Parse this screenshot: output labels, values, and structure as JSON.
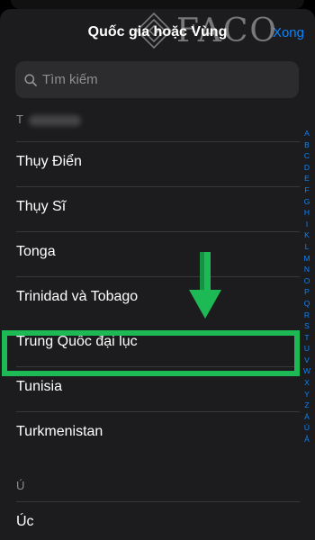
{
  "header": {
    "title": "Quốc gia hoặc Vùng",
    "done_label": "Xong"
  },
  "watermark": {
    "text": "FACO"
  },
  "search": {
    "placeholder": "Tìm kiếm"
  },
  "sections": [
    {
      "letter": "T",
      "items": [
        "Thụy Điển",
        "Thụy Sĩ",
        "Tonga",
        "Trinidad và Tobago",
        "Trung Quốc đại lục",
        "Tunisia",
        "Turkmenistan"
      ]
    },
    {
      "letter": "Ú",
      "items": [
        "Úc"
      ]
    }
  ],
  "highlighted_item": "Trung Quốc đại lục",
  "index_letters": [
    "A",
    "B",
    "C",
    "D",
    "E",
    "F",
    "G",
    "H",
    "I",
    "K",
    "L",
    "M",
    "N",
    "O",
    "P",
    "Q",
    "R",
    "S",
    "T",
    "U",
    "V",
    "W",
    "X",
    "Y",
    "Z",
    "Á",
    "Ú",
    "Ả"
  ],
  "colors": {
    "accent": "#0a84ff",
    "highlight": "#1db954",
    "background": "#1c1c1e"
  }
}
